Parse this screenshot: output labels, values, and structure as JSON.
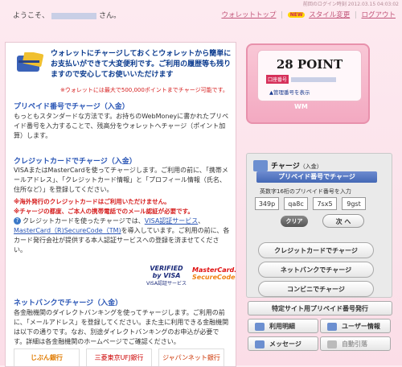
{
  "header": {
    "last_login": "前回のログイン時刻 2012.03.15 04:03:02",
    "greeting_prefix": "ようこそ、",
    "greeting_suffix": "さん。",
    "links": [
      "ウォレットトップ",
      "スタイル変更",
      "ログアウト"
    ],
    "new_badge": "NEW"
  },
  "intro": {
    "lines": [
      "ウォレットにチャージしておくとウォレットから簡単に",
      "お支払いができて大変便利です。ご利用の履歴等も残り",
      "ますので安心してお使いいただけます"
    ],
    "note": "※ウォレットには最大で500,000ポイントまでチャージ可能です。"
  },
  "prepaid": {
    "title": "プリペイド番号でチャージ（入金）",
    "text": "もっともスタンダードな方法です。お持ちのWebMoneyに書かれたプリペイド番号を入力することで、残高分をウォレットへチャージ（ポイント加算）します。"
  },
  "credit": {
    "title": "クレジットカードでチャージ（入金）",
    "text": "VISAまたはMasterCardを使ってチャージします。ご利用の前に、「携帯メールアドレス」、「クレジットカード情報」と「プロフィール情報（氏名、住所など）」を登録してください。",
    "warn1": "※海外発行のクレジットカードはご利用いただけません。",
    "warn2": "※チャージの都度、ご本人の携帯電話でのメール認証が必要です。",
    "note_prefix": "クレジットカードを使ったチャージでは、",
    "link1": "VISA認証サービス",
    "link_sep": "、",
    "link2": "MasterCard（R)SecureCode（TM)",
    "note_suffix": "を導入しています。ご利用の前に、各カード発行会社が提供する本人認証サービスへの登録を済ませてください。",
    "visa_logo": [
      "VERIFIED",
      "by VISA",
      "VISA認証サービス"
    ],
    "mc_logo": [
      "MasterCard.",
      "SecureCode."
    ]
  },
  "netbank": {
    "title": "ネットバンクでチャージ（入金）",
    "text": "各金融機関のダイレクトバンキングを使ってチャージします。ご利用の前に、「メールアドレス」を登録してください。また主に利用できる金融機関は以下の通りです。なお、別途ダイレクトバンキングのお申込が必要です。詳細は各金融機関のホームページでご確認ください。",
    "banks": [
      "じぶん銀行",
      "三菱東京UFJ銀行",
      "ジャパンネット銀行"
    ]
  },
  "card": {
    "points": "28 POINT",
    "mgmt_label": "口座番号",
    "mgmt_link": "▲管理番号を表示",
    "logo": "WM"
  },
  "charge_panel": {
    "title": "チャージ",
    "title_sub": "（入金）",
    "prepaid_bar": "プリペイド番号でチャージ",
    "hint": "英数字16桁のプリペイド番号を入力",
    "codes": [
      "349p",
      "qa8c",
      "7sx5",
      "9gst"
    ],
    "clear": "クリア",
    "next": "次 へ",
    "buttons": [
      "クレジットカードでチャージ",
      "ネットバンクでチャージ",
      "コンビニでチャージ"
    ]
  },
  "nav": {
    "wide": "特定サイト用プリペイド番号発行",
    "items": [
      "利用明細",
      "ユーザー情報",
      "メッセージ",
      "自動引落"
    ]
  }
}
